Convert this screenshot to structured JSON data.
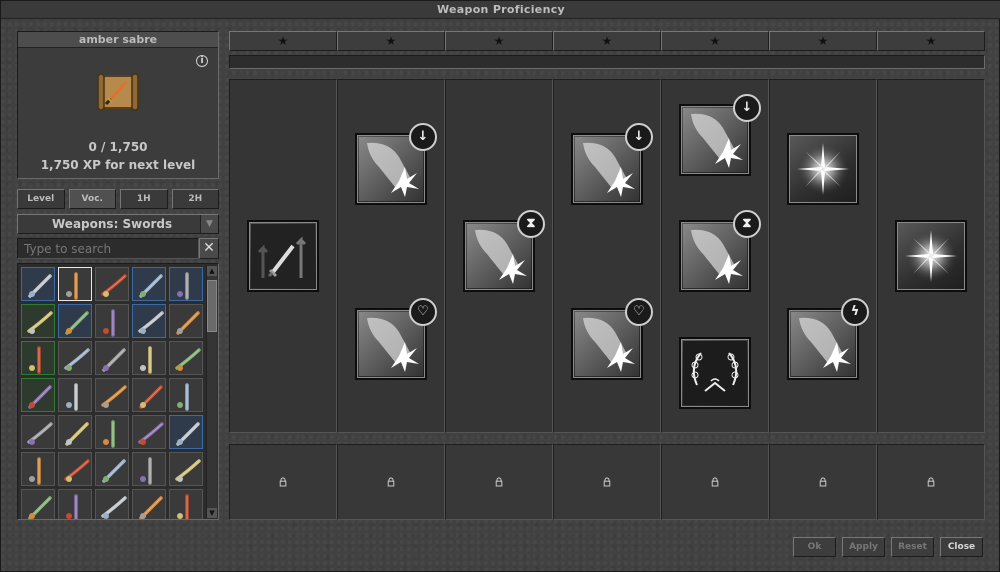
{
  "window": {
    "title": "Weapon Proficiency"
  },
  "item": {
    "name": "amber sabre",
    "xp_current": "0 / 1,750",
    "xp_next": "1,750 XP for next level",
    "info_icon": "info-icon",
    "item_icon": "scroll-sabre-icon"
  },
  "tabs": [
    {
      "label": "Level",
      "active": false
    },
    {
      "label": "Voc.",
      "active": true
    },
    {
      "label": "1H",
      "active": false
    },
    {
      "label": "2H",
      "active": false
    }
  ],
  "filter": {
    "selected": "Weapons: Swords",
    "arrow_icon": "chevron-down-icon"
  },
  "search": {
    "placeholder": "Type to search",
    "value": "",
    "clear_icon": "close-icon"
  },
  "weapons_grid": [
    {
      "frame": "blue",
      "icon": "curved-blade-icon"
    },
    {
      "frame": "sel",
      "icon": "amber-sabre-icon"
    },
    {
      "frame": "none",
      "icon": "fire-blade-icon"
    },
    {
      "frame": "blue",
      "icon": "dagger-icon"
    },
    {
      "frame": "blue",
      "icon": "wide-blade-icon"
    },
    {
      "frame": "green",
      "icon": "broadsword-icon"
    },
    {
      "frame": "blue",
      "icon": "purple-sword-icon"
    },
    {
      "frame": "none",
      "icon": "light-sword-icon"
    },
    {
      "frame": "blue",
      "icon": "crystal-sword-icon"
    },
    {
      "frame": "none",
      "icon": "spike-sword-icon"
    },
    {
      "frame": "green",
      "icon": "short-sword-icon"
    },
    {
      "frame": "none",
      "icon": "silver-sword-icon"
    },
    {
      "frame": "none",
      "icon": "iron-sword-icon"
    },
    {
      "frame": "none",
      "icon": "gold-sword-icon"
    },
    {
      "frame": "none",
      "icon": "small-dagger-icon"
    },
    {
      "frame": "green",
      "icon": "scimitar-icon"
    },
    {
      "frame": "none",
      "icon": "red-sword-icon"
    },
    {
      "frame": "none",
      "icon": "rapier-icon"
    },
    {
      "frame": "none",
      "icon": "sabre-icon"
    },
    {
      "frame": "none",
      "icon": "bone-sword-icon"
    },
    {
      "frame": "none",
      "icon": "knight-sword-icon"
    },
    {
      "frame": "none",
      "icon": "ice-sword-icon"
    },
    {
      "frame": "none",
      "icon": "dark-dagger-icon"
    },
    {
      "frame": "none",
      "icon": "blood-blade-icon"
    },
    {
      "frame": "blue",
      "icon": "red-scimitar-icon"
    },
    {
      "frame": "none",
      "icon": "runed-sword-icon"
    },
    {
      "frame": "none",
      "icon": "demon-sword-icon"
    },
    {
      "frame": "none",
      "icon": "axe-sword-icon"
    },
    {
      "frame": "none",
      "icon": "emerald-sword-icon"
    },
    {
      "frame": "none",
      "icon": "vine-sword-icon"
    },
    {
      "frame": "none",
      "icon": "gilded-sword-icon"
    },
    {
      "frame": "none",
      "icon": "jade-sword-icon"
    },
    {
      "frame": "none",
      "icon": "poison-sword-icon"
    },
    {
      "frame": "none",
      "icon": "teal-sword-icon"
    },
    {
      "frame": "none",
      "icon": "steel-sword-icon"
    }
  ],
  "levels": [
    {
      "star": "★",
      "lock": "🔒"
    },
    {
      "star": "★",
      "lock": "🔒"
    },
    {
      "star": "★",
      "lock": "🔒"
    },
    {
      "star": "★",
      "lock": "🔒"
    },
    {
      "star": "★",
      "lock": "🔒"
    },
    {
      "star": "★",
      "lock": "🔒"
    },
    {
      "star": "★",
      "lock": "🔒"
    }
  ],
  "progress": {
    "fraction": 0
  },
  "perks": [
    [
      {
        "icon": "sword-upgrade-icon",
        "badge": ""
      }
    ],
    [
      {
        "icon": "strike-icon",
        "badge": "↓",
        "badge_name": "down-arrow-badge"
      },
      {
        "icon": "strike-icon",
        "badge": "♡",
        "badge_name": "heart-badge"
      }
    ],
    [
      {
        "icon": "strike-icon",
        "badge": "⧗",
        "badge_name": "hourglass-badge"
      }
    ],
    [
      {
        "icon": "strike-icon",
        "badge": "↓",
        "badge_name": "down-arrow-badge"
      },
      {
        "icon": "strike-icon",
        "badge": "♡",
        "badge_name": "heart-badge"
      }
    ],
    [
      {
        "icon": "strike-icon",
        "badge": "↓",
        "badge_name": "down-arrow-badge"
      },
      {
        "icon": "strike-icon",
        "badge": "⧗",
        "badge_name": "hourglass-badge"
      },
      {
        "icon": "laurel-wreath-icon",
        "badge": ""
      }
    ],
    [
      {
        "icon": "starburst-icon",
        "badge": ""
      },
      {
        "icon": "strike-icon",
        "badge": "ϟ",
        "badge_name": "lightning-badge"
      }
    ],
    [
      {
        "icon": "starburst-icon",
        "badge": ""
      }
    ]
  ],
  "footer": {
    "ok": "Ok",
    "apply": "Apply",
    "reset": "Reset",
    "close": "Close"
  }
}
